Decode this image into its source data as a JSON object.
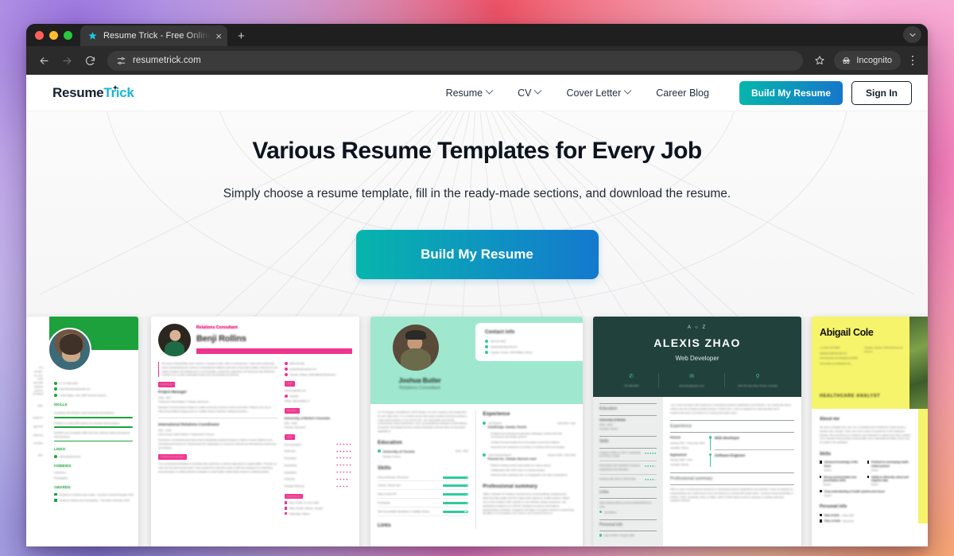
{
  "browser": {
    "tab": {
      "title": "Resume Trick - Free Online R",
      "favicon": "star-icon",
      "close": "×"
    },
    "new_tab": "+",
    "tabstrip_collapse": "chevron-down-icon",
    "back": "←",
    "forward": "→",
    "reload": "↻",
    "site_info": "tune-icon",
    "url": "resumetrick.com",
    "bookmark": "star-outline-icon",
    "profile_label": "Incognito",
    "profile_icon": "incognito-hat-icon",
    "menu": "kebab-menu-icon"
  },
  "site": {
    "logo": {
      "part1": "Resume",
      "part2": "Trick",
      "star": "✦"
    },
    "nav": [
      {
        "label": "Resume",
        "has_caret": true
      },
      {
        "label": "CV",
        "has_caret": true
      },
      {
        "label": "Cover Letter",
        "has_caret": true
      },
      {
        "label": "Career Blog",
        "has_caret": false
      }
    ],
    "build_button": "Build My Resume",
    "signin_button": "Sign In"
  },
  "hero": {
    "title": "Various Resume Templates for Every Job",
    "subtitle": "Simply choose a resume template, fill in the ready-made sections, and download the resume.",
    "cta": "Build My Resume"
  },
  "templates": [
    {
      "id": "template-green-nurse",
      "accent": "#1da13c",
      "heading_partial": "nks",
      "phone": "+1 717-951-4287",
      "email": "DawnTEubanks@gmail.com",
      "location": "United States, York, 2867 Simpson Avenue",
      "sections": {
        "skills_title": "SKILLS",
        "skills": [
          "Familiarity with infection control protocols and practices",
          "Proficient in using EHR systems for accurate documentation",
          "Excellent communication skills that foster effective patient interactions and teamwork"
        ],
        "links_title": "LINKS",
        "links": [
          "dawneubankonurse"
        ],
        "hobbies_title": "HOBBIES",
        "hobbies": [
          "Gardening",
          "Photography"
        ],
        "awards_title": "AWARDS",
        "awards": [
          "Excellence in Patient Care Award - Sunshine General Hospital, 2020",
          "Academic Achievement Scholarship - York State University, 2018"
        ]
      },
      "left_fragments": [
        "th a",
        "ed care.",
        "es, con-",
        "s and",
        "port with",
        "oughout",
        "used on",
        "ce-based",
        "pital,",
        "curate di-",
        "gians for",
        "cribed by",
        "evention",
        "rsity."
      ]
    },
    {
      "id": "template-pink-relations",
      "accent": "#ef338f",
      "job_title": "Relations Consultant",
      "name": "Benji Rollins",
      "summary": "My name is Benji Rollins and I moved to Canada in 2011. Since my arrival here, I have been passionate about understanding the nuances of international relations and how to best foster positive outcomes for all parties involved. My background in communication, grassroots organizing, and advocacy has effectively enabled me to create meaningful impact both domestically and abroad.",
      "phone": "0406 120 308",
      "email": "benjirollins@outlook.com",
      "location": "Canada, Ottawa, 1056 Millbank Boulevard",
      "experience_title": "Experience",
      "experience": [
        {
          "role": "Project Manager",
          "dates": "2015 - 2017",
          "company": "YouSource Technologies  /  Canada, Vancouver",
          "desc": "Managed several projects related to conflict resolutions between local communities. Played a key role in influencing political engagements on multiple levels of decision-making processes."
        },
        {
          "role": "International Relations Coordinator",
          "dates": "2017 - 2019",
          "company": "InterConnect United Nations  /  Switzerland, Geneva",
          "desc": "Developed, coordinated and implemented strategically practical programs related to peace initiatives and international development. Represented the organization in numerous national and international conferences and debates."
        }
      ],
      "summary_title": "Professional summary",
      "summary_body": "I am a professional Relations Consultant with experience in diverse approaches to global affairs. Through my work over the past several years I have acquired an extensive range of skill sets ranging from networking and persuasion to crafting effective strategies to build healthy relationships between conflicting parties.",
      "links_title": "Links",
      "links": [
        "www.benjirollins.net",
        "LinkedIn",
        "Twitter: @benjirollins_ir"
      ],
      "education_title": "Education",
      "education": {
        "school": "University of British Columbia",
        "dates": "2011 - 2015",
        "place": "Canada, Vancouver"
      },
      "skills_title": "Skills",
      "skills": [
        {
          "name": "Communication",
          "rating": 5
        },
        {
          "name": "Diplomacy",
          "rating": 5
        },
        {
          "name": "Persuasion",
          "rating": 5
        },
        {
          "name": "Networking",
          "rating": 5
        },
        {
          "name": "Negotiation",
          "rating": 5
        },
        {
          "name": "Advocacy",
          "rating": 4
        },
        {
          "name": "Strategic Planning",
          "rating": 4
        }
      ],
      "personal_title": "Personal info",
      "personal": [
        "Date of birth: 21 June 1984",
        "Place of birth: Taichou, Jiangsu",
        "Nationality: Filipino"
      ]
    },
    {
      "id": "template-mint-designer",
      "accent": "#2ecb9f",
      "name": "Joshua Butler",
      "job_title": "Relations Consultant",
      "contact_title": "Contact info",
      "phone": "400 101 0618",
      "email": "joshuabutler@gmail.com",
      "location": "Canada, Toronto, 7609 William Circles",
      "summary": "I'm UX designer specialized in UI/UX Design. I've been working in the design field for over eight years. I'm a creative person that enjoys creating and pixel pushing to create great products. In my current role, I am responsible user-centric, contemporary visual experiences—from conceptualizing strategies to final delivery of projects. My background also includes illustration and animation for interactive applications.",
      "experience_title": "Experience",
      "experience": [
        {
          "role": "UX Designer",
          "dates": "April 2018 - Now",
          "company": "ZebuiDesign, Canada, Toronto",
          "bullets": [
            "Designed and developed responsive webpages, worked with web components and design systems",
            "Created concept designs for an innovative ecommerce platform",
            "Improved user experience by revision of existing UI/UX and designs"
          ]
        },
        {
          "role": "Lead Visual Designer",
          "dates": "October 2015 - April 2018",
          "company": "Pixerone Inc., Canada, Harcover court",
          "bullets": [
            "Refined existing product style guides for various clients",
            "Collaborated with UI/UX team on concept designs",
            "Partnered with marketing team on infographics and data visualizations"
          ]
        }
      ],
      "education_title": "Education",
      "education": {
        "school": "University of Toronto",
        "dates": "2013 - 2017",
        "place": "Canada, Toronto"
      },
      "skills_title": "Skills",
      "skills": [
        {
          "name": "Adobe Illustrator, Photoshop",
          "pct": 96
        },
        {
          "name": "InVision, Sketch App",
          "pct": 96
        },
        {
          "name": "Figma, Azure RP",
          "pct": 96
        },
        {
          "name": "Prototyping",
          "pct": 96
        },
        {
          "name": "Web Accessibility Standards & Usability Testing",
          "pct": 86
        }
      ],
      "links_title": "Links",
      "summary_title": "Professional summary",
      "summary_body": "Highly motivated UX designer experienced in conceptualizing, designing and delivering high-quality work from large-scale projects to smaller projects. Skilled user-centric designer with expertise in user interface design experience, web applications designed up to WCAG standards as well as presentations graphics/video production. Engaged in all stages of projects involved in researching, identifies & communicates user needs & user-centered focus on"
    },
    {
      "id": "template-dark-webdev",
      "accent": "#3fc3a4",
      "monogram": "A ○ Z",
      "name": "ALEXIS ZHAO",
      "job_title": "Web Developer",
      "phone": "762 386 0509",
      "email": "alexiszhao@yahoo.com",
      "location": "2367 6th Stop Alley, Nimbin, Australia",
      "intro": "I am a web developer with experience in developing dynamic applications and websites. I am passionate about writing code and creating beautiful designs. Furthermore, I have an aptitude for understanding user's requirements and a commitment to meeting their goals online.",
      "education_title": "Education",
      "education": {
        "school": "University of Nimbin",
        "dates": "2015 - 2019",
        "place": "Australia, Nimbin"
      },
      "skills_title": "Skills",
      "skills": [
        {
          "name": "Coding in HTML 5, CSS 3, JavaScript and Ruby on Rails",
          "rating": 5
        },
        {
          "name": "Developing User Interfaces, Dynamic Applications and Websites",
          "rating": 4
        },
        {
          "name": "Working with AJAX & JSON Data",
          "rating": 4
        }
      ],
      "links_title": "Links",
      "links": [
        "https://stackoverflow.com/users/5292368/Alexis-zhao",
        "AlexisZhao"
      ],
      "personal_title": "Personal info",
      "personal": [
        "Date of birth: 2 August 1992"
      ],
      "experience_title": "Experience",
      "experience": [
        {
          "company": "Netsute",
          "dates": "January 2017 - December 2019",
          "place": "Australia, Sidney",
          "role": "Web developer"
        },
        {
          "company": "BigDataSoft",
          "dates": "January 2020 - Now",
          "place": "Australia, Nimbin",
          "role": "Software Engineer"
        }
      ],
      "summary_title": "Professional summary",
      "summary_body": "With 3+ years of professional experience in developing dynamic applications and websites, I have an aptitude for understanding user requirements and a commitment to meeting their goals online. I possess strong knowledge of HTML5, CSS3, JavaScript, Ruby on Rails, AJAX & JSON Data as well as expertise in creating optimized Database Queries."
    },
    {
      "id": "template-yellow-analyst",
      "accent": "#f6f46a",
      "name": "Abigail Cole",
      "job_title": "HEALTHCARE ANALYST",
      "phone": "+1 (115) 347-6965",
      "email": "abigailcole@hotmail.com",
      "links": [
        "www.linkedin.com/abigail-cole9096",
        "www.twitter.com/abigail-cole_"
      ],
      "location": "Canada, Quebec, 5619 Drummond Avenue",
      "about_title": "About me",
      "about_body": "My name is Abigail Cole, and I am a Canadian-born Healthcare Analyst living in Quebec City, Canada. I have over seven years of experience in the healthcare industry. My commitment to excellence and dedication to patient care have enabled me to develop strong problem-solving skills, keen organizational ability, and an eye for detail in the workplace.",
      "skills_title": "Skills",
      "skills": [
        {
          "name": "Advanced knowledge of MS Excel",
          "level": "Expert"
        },
        {
          "name": "Proficient in developing health-related policies",
          "level": "Expert"
        },
        {
          "name": "Strong communication and presentation skills",
          "level": "Expert"
        },
        {
          "name": "Ability to efficiently collect and organise data",
          "level": "Expert"
        },
        {
          "name": "Deep understanding of health systems and issues",
          "level": "Expert"
        }
      ],
      "personal_title": "Personal info",
      "personal": [
        {
          "k": "Date of birth",
          "v": "1 May 1987"
        },
        {
          "k": "Place of birth",
          "v": "Vancouver"
        }
      ]
    }
  ]
}
